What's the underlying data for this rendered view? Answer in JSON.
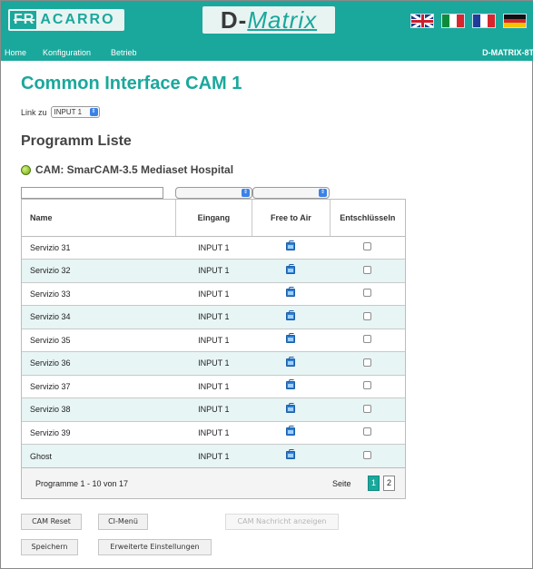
{
  "header": {
    "logo_left_fr": "FR",
    "logo_left_rest": "ACARRO",
    "logo_center_d": "D-",
    "logo_center_matrix": "Matrix",
    "brand_right": "D-MATRIX-8T",
    "nav": [
      "Home",
      "Konfiguration",
      "Betrieb"
    ],
    "flags": [
      "flag-uk-icon",
      "flag-italy-icon",
      "flag-france-icon",
      "flag-germany-icon"
    ]
  },
  "page_title": "Common Interface CAM 1",
  "link": {
    "label": "Link zu",
    "value": "INPUT 1"
  },
  "section_title": "Programm Liste",
  "cam": {
    "status_color": "#7ab62a",
    "label": "CAM: SmarCAM-3.5 Mediaset Hospital"
  },
  "filters": {
    "search_value": "",
    "select1_value": "",
    "select2_value": ""
  },
  "table": {
    "headers": [
      "Name",
      "Eingang",
      "Free to Air",
      "Entschlüsseln"
    ],
    "rows": [
      {
        "name": "Servizio 31",
        "input": "INPUT 1",
        "fta": "tv-icon",
        "decrypt": false
      },
      {
        "name": "Servizio 32",
        "input": "INPUT 1",
        "fta": "tv-icon",
        "decrypt": false
      },
      {
        "name": "Servizio 33",
        "input": "INPUT 1",
        "fta": "tv-icon",
        "decrypt": false
      },
      {
        "name": "Servizio 34",
        "input": "INPUT 1",
        "fta": "tv-icon",
        "decrypt": false
      },
      {
        "name": "Servizio 35",
        "input": "INPUT 1",
        "fta": "tv-icon",
        "decrypt": false
      },
      {
        "name": "Servizio 36",
        "input": "INPUT 1",
        "fta": "tv-icon",
        "decrypt": false
      },
      {
        "name": "Servizio 37",
        "input": "INPUT 1",
        "fta": "tv-icon",
        "decrypt": false
      },
      {
        "name": "Servizio 38",
        "input": "INPUT 1",
        "fta": "tv-icon",
        "decrypt": false
      },
      {
        "name": "Servizio 39",
        "input": "INPUT 1",
        "fta": "tv-icon",
        "decrypt": false
      },
      {
        "name": "Ghost",
        "input": "INPUT 1",
        "fta": "tv-icon",
        "decrypt": false
      }
    ]
  },
  "pager": {
    "range": "Programme 1 - 10 von 17",
    "page_label": "Seite",
    "pages": [
      "1",
      "2"
    ],
    "current": "1"
  },
  "buttons": {
    "cam_reset": "CAM Reset",
    "ci_menu": "CI-Menü",
    "cam_message": "CAM Nachricht anzeigen",
    "save": "Speichern",
    "advanced": "Erweiterte Einstellungen"
  },
  "colors": {
    "accent": "#1aa89c",
    "row_alt": "#e7f5f4"
  }
}
